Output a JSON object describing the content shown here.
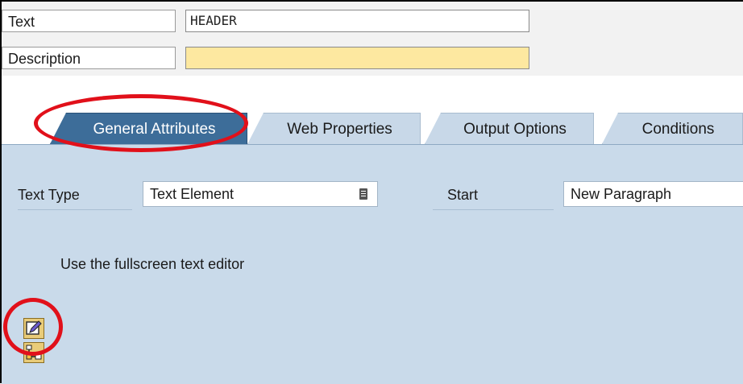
{
  "header": {
    "text_label": "Text",
    "text_value": "HEADER",
    "description_label": "Description",
    "description_value": ""
  },
  "tabs": [
    {
      "label": "General Attributes",
      "active": true
    },
    {
      "label": "Web Properties",
      "active": false
    },
    {
      "label": "Output Options",
      "active": false
    },
    {
      "label": "Conditions",
      "active": false
    }
  ],
  "panel": {
    "text_type_label": "Text Type",
    "text_type_value": "Text Element",
    "start_label": "Start",
    "start_value": "New Paragraph",
    "editor_hint": "Use the fullscreen text editor"
  },
  "buttons": [
    {
      "icon": "pencil-edit-icon"
    },
    {
      "icon": "layout-tree-icon"
    }
  ],
  "colors": {
    "panel_bg": "#c9daea",
    "active_tab": "#3d6d99",
    "required_field": "#fde8a0",
    "highlight": "#e1101a"
  }
}
